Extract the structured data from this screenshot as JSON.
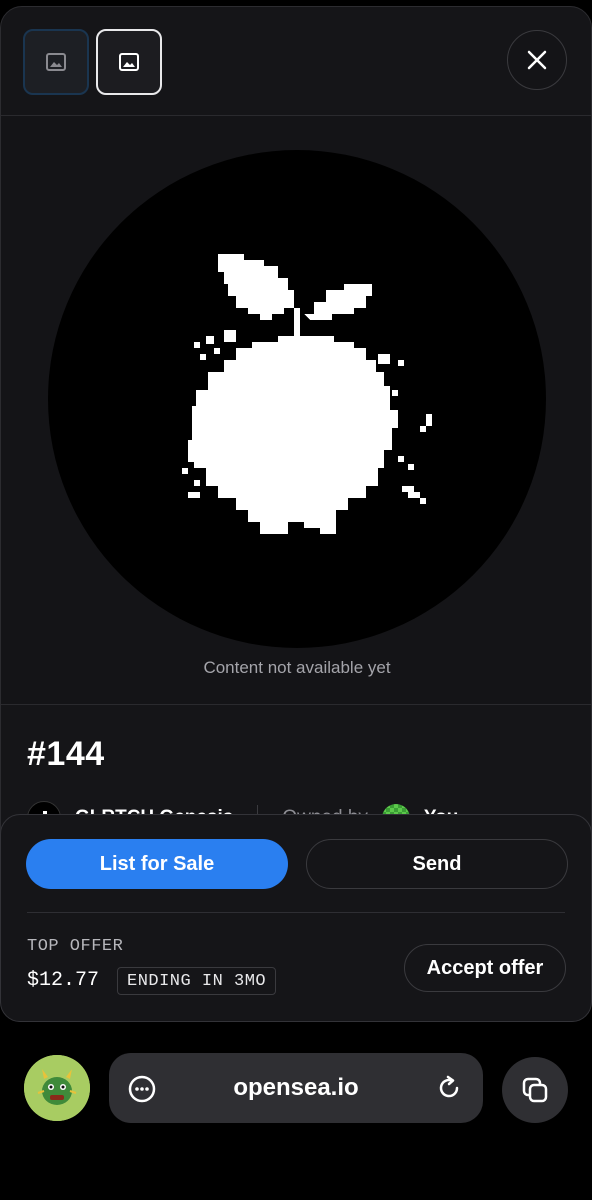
{
  "media": {
    "caption": "Content not available yet"
  },
  "nft": {
    "title": "#144",
    "collection_name": "GLRTCH Genesis",
    "owned_by_label": "Owned by",
    "owner_name": "You"
  },
  "actions": {
    "list_for_sale": "List for Sale",
    "send": "Send"
  },
  "offer": {
    "label": "TOP OFFER",
    "price": "$12.77",
    "ending": "ENDING IN 3MO",
    "accept_label": "Accept offer"
  },
  "browser": {
    "url": "opensea.io"
  },
  "colors": {
    "primary": "#2a7ff0",
    "background": "#151518",
    "page": "#000000"
  },
  "icons": [
    "image-icon",
    "close-icon",
    "apple-art",
    "more-icon",
    "reload-icon",
    "tabs-icon"
  ]
}
